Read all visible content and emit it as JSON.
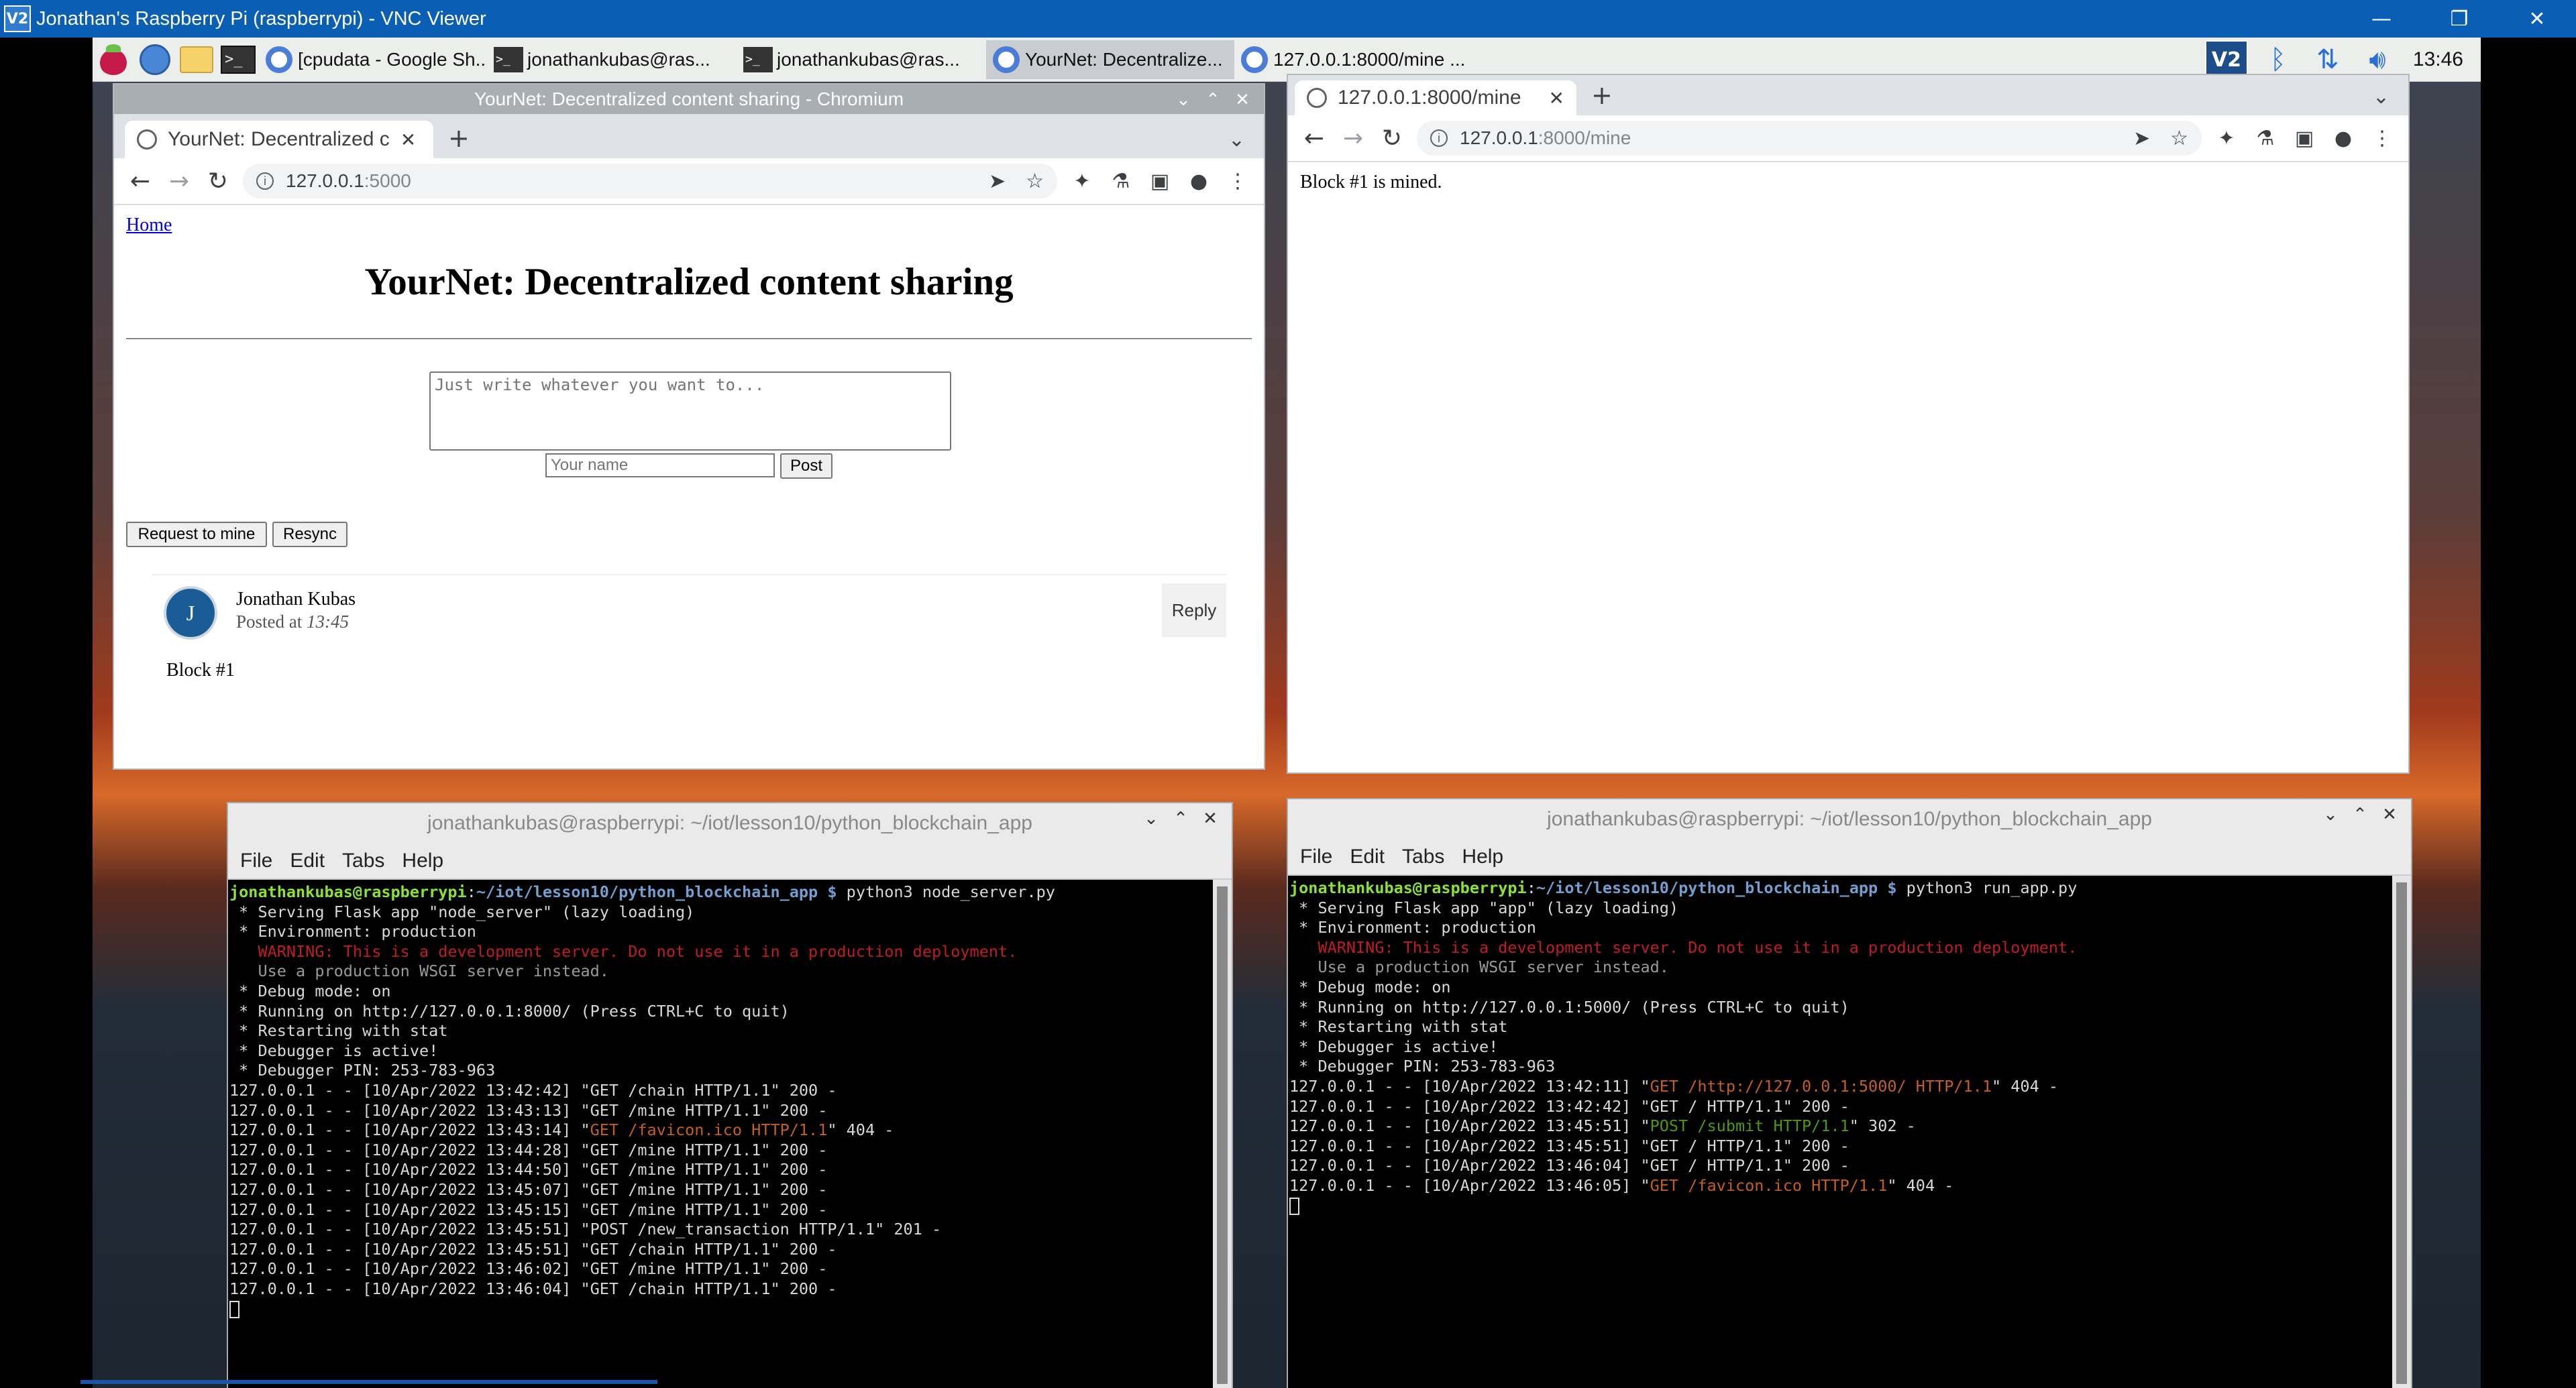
{
  "vnc": {
    "title": "Jonathan's Raspberry Pi (raspberrypi) - VNC Viewer",
    "logo": "V2",
    "controls": [
      "minimize-icon",
      "restore-icon",
      "close-icon"
    ]
  },
  "taskbar": {
    "tasks": [
      {
        "label": "[cpudata - Google Sh...",
        "icon": "chrome-icon"
      },
      {
        "label": "jonathankubas@ras...",
        "icon": "terminal-icon"
      },
      {
        "label": "jonathankubas@ras...",
        "icon": "terminal-icon"
      },
      {
        "label": "YourNet: Decentralize...",
        "icon": "chrome-icon"
      },
      {
        "label": "127.0.0.1:8000/mine ...",
        "icon": "chrome-icon"
      }
    ],
    "term_glyph": ">_",
    "clock": "13:46"
  },
  "left_browser": {
    "window_title": "YourNet: Decentralized content sharing - Chromium",
    "tab_title": "YourNet: Decentralized c",
    "url": "127.0.0.1",
    "url_port": ":5000",
    "page": {
      "home_link": "Home",
      "heading": "YourNet: Decentralized content sharing",
      "textarea_placeholder": "Just write whatever you want to...",
      "name_placeholder": "Your name",
      "post_button": "Post",
      "mine_button": "Request to mine",
      "resync_button": "Resync",
      "post": {
        "avatar_letter": "J",
        "author": "Jonathan Kubas",
        "posted_prefix": "Posted at ",
        "posted_time": "13:45",
        "reply": "Reply",
        "content": "Block #1"
      }
    }
  },
  "right_browser": {
    "tab_title": "127.0.0.1:8000/mine",
    "url": "127.0.0.1",
    "url_rest": ":8000/mine",
    "page_text": "Block #1 is mined."
  },
  "terminal_left": {
    "title": "jonathankubas@raspberrypi: ~/iot/lesson10/python_blockchain_app",
    "menu": [
      "File",
      "Edit",
      "Tabs",
      "Help"
    ],
    "prompt_user": "jonathankubas@raspberrypi",
    "prompt_path": "~/iot/lesson10/python_blockchain_app",
    "command": "python3 node_server.py",
    "lines": [
      {
        "t": " * Serving Flask app \"node_server\" (lazy loading)",
        "c": ""
      },
      {
        "t": " * Environment: production",
        "c": ""
      },
      {
        "t": "   WARNING: This is a development server. Do not use it in a production deployment.",
        "c": "c-red"
      },
      {
        "t": "   Use a production WSGI server instead.",
        "c": "c-gray"
      },
      {
        "t": " * Debug mode: on",
        "c": ""
      },
      {
        "t": " * Running on http://127.0.0.1:8000/ (Press CTRL+C to quit)",
        "c": ""
      },
      {
        "t": " * Restarting with stat",
        "c": ""
      },
      {
        "t": " * Debugger is active!",
        "c": ""
      },
      {
        "t": " * Debugger PIN: 253-783-963",
        "c": ""
      },
      {
        "t": "127.0.0.1 - - [10/Apr/2022 13:42:42] \"GET /chain HTTP/1.1\" 200 -",
        "c": ""
      },
      {
        "t": "127.0.0.1 - - [10/Apr/2022 13:43:13] \"GET /mine HTTP/1.1\" 200 -",
        "c": ""
      },
      {
        "pre": "127.0.0.1 - - [10/Apr/2022 13:43:14] \"",
        "hl": "GET /favicon.ico HTTP/1.1",
        "post": "\" 404 -",
        "c": "c-orange"
      },
      {
        "t": "127.0.0.1 - - [10/Apr/2022 13:44:28] \"GET /mine HTTP/1.1\" 200 -",
        "c": ""
      },
      {
        "t": "127.0.0.1 - - [10/Apr/2022 13:44:50] \"GET /mine HTTP/1.1\" 200 -",
        "c": ""
      },
      {
        "t": "127.0.0.1 - - [10/Apr/2022 13:45:07] \"GET /mine HTTP/1.1\" 200 -",
        "c": ""
      },
      {
        "t": "127.0.0.1 - - [10/Apr/2022 13:45:15] \"GET /mine HTTP/1.1\" 200 -",
        "c": ""
      },
      {
        "t": "127.0.0.1 - - [10/Apr/2022 13:45:51] \"POST /new_transaction HTTP/1.1\" 201 -",
        "c": ""
      },
      {
        "t": "127.0.0.1 - - [10/Apr/2022 13:45:51] \"GET /chain HTTP/1.1\" 200 -",
        "c": ""
      },
      {
        "t": "127.0.0.1 - - [10/Apr/2022 13:46:02] \"GET /mine HTTP/1.1\" 200 -",
        "c": ""
      },
      {
        "t": "127.0.0.1 - - [10/Apr/2022 13:46:04] \"GET /chain HTTP/1.1\" 200 -",
        "c": ""
      }
    ]
  },
  "terminal_right": {
    "title": "jonathankubas@raspberrypi: ~/iot/lesson10/python_blockchain_app",
    "menu": [
      "File",
      "Edit",
      "Tabs",
      "Help"
    ],
    "prompt_user": "jonathankubas@raspberrypi",
    "prompt_path": "~/iot/lesson10/python_blockchain_app",
    "command": "python3 run_app.py",
    "lines": [
      {
        "t": " * Serving Flask app \"app\" (lazy loading)",
        "c": ""
      },
      {
        "t": " * Environment: production",
        "c": ""
      },
      {
        "t": "   WARNING: This is a development server. Do not use it in a production deployment.",
        "c": "c-red"
      },
      {
        "t": "   Use a production WSGI server instead.",
        "c": "c-gray"
      },
      {
        "t": " * Debug mode: on",
        "c": ""
      },
      {
        "t": " * Running on http://127.0.0.1:5000/ (Press CTRL+C to quit)",
        "c": ""
      },
      {
        "t": " * Restarting with stat",
        "c": ""
      },
      {
        "t": " * Debugger is active!",
        "c": ""
      },
      {
        "t": " * Debugger PIN: 253-783-963",
        "c": ""
      },
      {
        "pre": "127.0.0.1 - - [10/Apr/2022 13:42:11] \"",
        "hl": "GET /http://127.0.0.1:5000/ HTTP/1.1",
        "post": "\" 404 -",
        "c": "c-orange"
      },
      {
        "t": "127.0.0.1 - - [10/Apr/2022 13:42:42] \"GET / HTTP/1.1\" 200 -",
        "c": ""
      },
      {
        "pre": "127.0.0.1 - - [10/Apr/2022 13:45:51] \"",
        "hl": "POST /submit HTTP/1.1",
        "post": "\" 302 -",
        "c": "c-green"
      },
      {
        "t": "127.0.0.1 - - [10/Apr/2022 13:45:51] \"GET / HTTP/1.1\" 200 -",
        "c": ""
      },
      {
        "t": "127.0.0.1 - - [10/Apr/2022 13:46:04] \"GET / HTTP/1.1\" 200 -",
        "c": ""
      },
      {
        "pre": "127.0.0.1 - - [10/Apr/2022 13:46:05] \"",
        "hl": "GET /favicon.ico HTTP/1.1",
        "post": "\" 404 -",
        "c": "c-orange"
      }
    ]
  }
}
